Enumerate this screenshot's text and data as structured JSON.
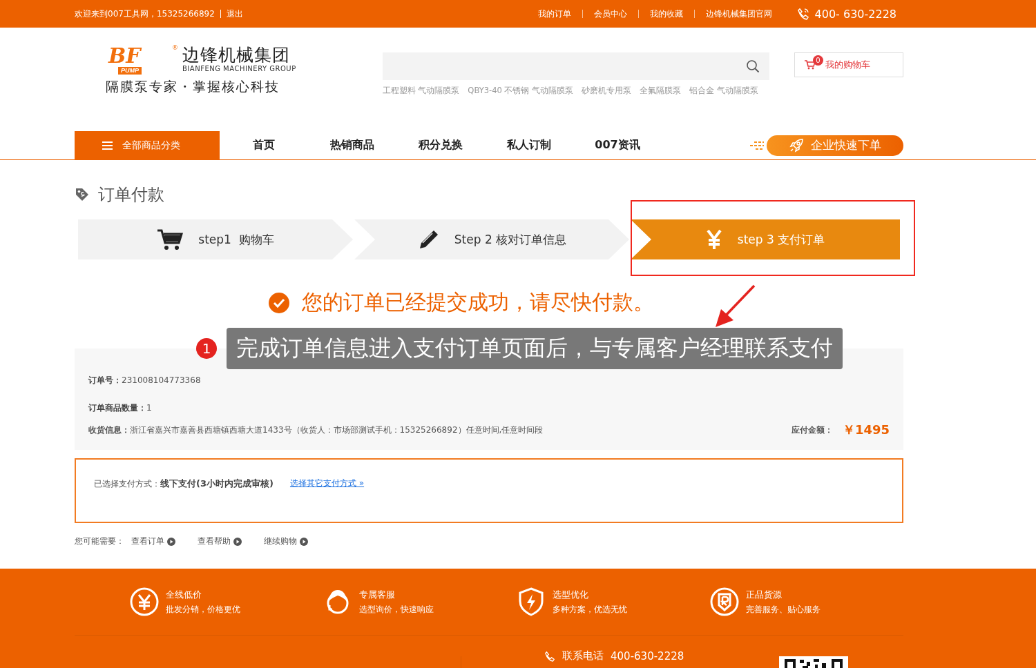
{
  "top_bar": {
    "welcome": "欢迎来到007工具网，15325266892",
    "logout": "退出",
    "links": [
      "我的订单",
      "会员中心",
      "我的收藏",
      "边锋机械集团官网"
    ],
    "phone": "400- 630-2228"
  },
  "header": {
    "logo": {
      "mark": "BF",
      "mark_sub": "PUMP",
      "registered": "®",
      "name": "边锋机械集团",
      "english": "BIANFENG MACHINERY GROUP",
      "slogan": "隔膜泵专家・掌握核心科技"
    },
    "search": {
      "hot_tags": [
        "工程塑料 气动隔膜泵",
        "QBY3-40 不锈钢 气动隔膜泵",
        "砂磨机专用泵",
        "全氟隔膜泵",
        "铝合金 气动隔膜泵"
      ]
    },
    "cart": {
      "count": "0",
      "label": "我的购物车"
    }
  },
  "nav": {
    "category": "全部商品分类",
    "items": [
      "首页",
      "热销商品",
      "积分兑换",
      "私人订制",
      "007资讯"
    ],
    "quick_order": "企业快速下单"
  },
  "page_title": "订单付款",
  "steps": [
    {
      "kind": "cart",
      "label": "step1  购物车",
      "selected": false
    },
    {
      "kind": "pencil",
      "label": "Step 2 核对订单信息",
      "selected": false
    },
    {
      "kind": "yen",
      "label": "step 3 支付订单",
      "selected": true
    }
  ],
  "success": "您的订单已经提交成功，请尽快付款。",
  "annotation": {
    "number": "1",
    "text": "完成订单信息进入支付订单页面后，与专属客户经理联系支付"
  },
  "order": {
    "fields": [
      {
        "label": "订单号：",
        "value": "231008104773368"
      },
      {
        "label": "订单商品数量：",
        "value": "1"
      },
      {
        "label": "收货信息：",
        "value": "浙江省嘉兴市嘉善县西塘镇西塘大道1433号（收货人：市场部测试手机：15325266892）任意时间,任意时间段"
      }
    ],
    "amount_label": "应付金额：",
    "amount": "￥1495"
  },
  "payment": {
    "label": "已选择支付方式：",
    "method": "线下支付(3小时内完成审核)",
    "change_link": "选择其它支付方式 »"
  },
  "suggestions": {
    "label": "您可能需要：",
    "links": [
      "查看订单",
      "查看帮助",
      "继续购物"
    ]
  },
  "footer": {
    "features": [
      {
        "kind": "yen",
        "title": "全线低价",
        "desc": "批发分销，价格更优"
      },
      {
        "kind": "service",
        "title": "专属客服",
        "desc": "选型询价，快速响应"
      },
      {
        "kind": "shield",
        "title": "选型优化",
        "desc": "多种方案，优选无忧"
      },
      {
        "kind": "badge",
        "title": "正品货源",
        "desc": "完善服务、贴心服务"
      }
    ],
    "contact": {
      "label": "联系电话",
      "phone": "400-630-2228"
    }
  }
}
